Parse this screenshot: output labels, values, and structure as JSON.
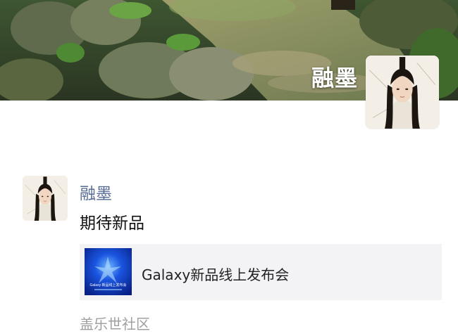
{
  "profile": {
    "name": "融墨"
  },
  "post": {
    "author": "融墨",
    "text": "期待新品",
    "link": {
      "title": "Galaxy新品线上发布会",
      "thumb_text": "Galaxy 新品线上发布会"
    },
    "source": "盖乐世社区"
  },
  "colors": {
    "author_name": "#576b95",
    "card_bg": "#f3f3f5",
    "source_text": "#a0a0a0",
    "thumb_blue": "#0b2fb8"
  }
}
